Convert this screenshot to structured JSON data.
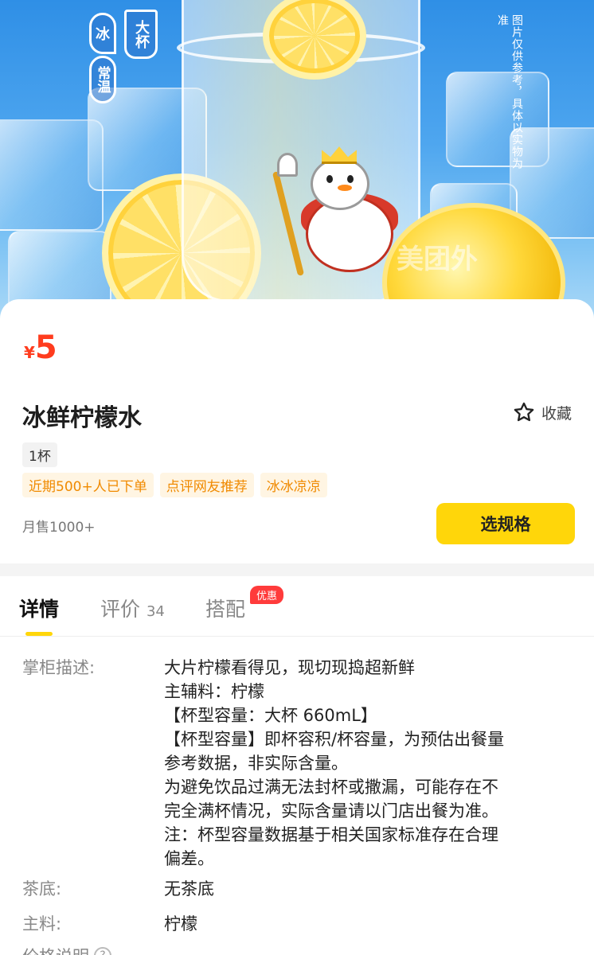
{
  "hero": {
    "badge_ice": "冰",
    "badge_big": "大杯",
    "badge_normal": "常温",
    "disclaimer": "图片仅供参考，具体以实物为准",
    "watermark": "美团外"
  },
  "product": {
    "currency": "¥",
    "price": "5",
    "name": "冰鲜柠檬水",
    "favorite_label": "收藏",
    "spec_tag": "1杯",
    "tags": [
      "近期500+人已下单",
      "点评网友推荐",
      "冰冰凉凉"
    ],
    "monthly_sales": "月售1000+",
    "select_button": "选规格"
  },
  "tabs": {
    "details": "详情",
    "reviews": "评价",
    "reviews_count": "34",
    "combo": "搭配",
    "promo_badge": "优惠"
  },
  "details": {
    "desc_label": "掌柜描述:",
    "desc_lines": [
      "大片柠檬看得见，现切现捣超新鲜",
      "主辅料：柠檬",
      "【杯型容量：大杯 660mL】",
      "【杯型容量】即杯容积/杯容量，为预估出餐量",
      "参考数据，非实际含量。",
      "为避免饮品过满无法封杯或撒漏，可能存在不",
      "完全满杯情况，实际含量请以门店出餐为准。",
      "注：杯型容量数据基于相关国家标准存在合理",
      "偏差。"
    ],
    "tea_label": "茶底:",
    "tea_value": "无茶底",
    "main_label": "主料:",
    "main_value": "柠檬",
    "price_label": "价格说明"
  },
  "colors": {
    "accent_yellow": "#ffd60a",
    "price_red": "#ff3c1e",
    "tag_orange": "#f08a00",
    "promo_red": "#ff3b3b"
  }
}
